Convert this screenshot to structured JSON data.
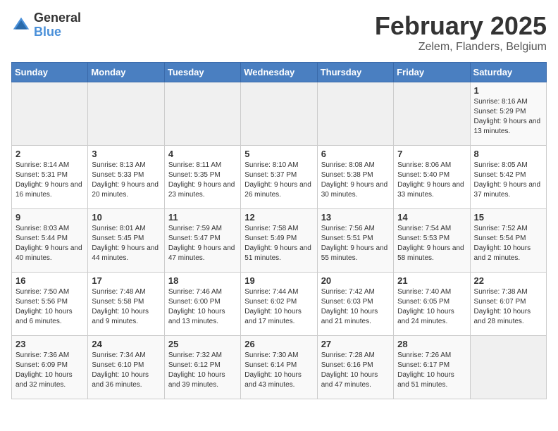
{
  "header": {
    "logo_general": "General",
    "logo_blue": "Blue",
    "title": "February 2025",
    "location": "Zelem, Flanders, Belgium"
  },
  "weekdays": [
    "Sunday",
    "Monday",
    "Tuesday",
    "Wednesday",
    "Thursday",
    "Friday",
    "Saturday"
  ],
  "weeks": [
    [
      {
        "day": "",
        "info": ""
      },
      {
        "day": "",
        "info": ""
      },
      {
        "day": "",
        "info": ""
      },
      {
        "day": "",
        "info": ""
      },
      {
        "day": "",
        "info": ""
      },
      {
        "day": "",
        "info": ""
      },
      {
        "day": "1",
        "info": "Sunrise: 8:16 AM\nSunset: 5:29 PM\nDaylight: 9 hours and 13 minutes."
      }
    ],
    [
      {
        "day": "2",
        "info": "Sunrise: 8:14 AM\nSunset: 5:31 PM\nDaylight: 9 hours and 16 minutes."
      },
      {
        "day": "3",
        "info": "Sunrise: 8:13 AM\nSunset: 5:33 PM\nDaylight: 9 hours and 20 minutes."
      },
      {
        "day": "4",
        "info": "Sunrise: 8:11 AM\nSunset: 5:35 PM\nDaylight: 9 hours and 23 minutes."
      },
      {
        "day": "5",
        "info": "Sunrise: 8:10 AM\nSunset: 5:37 PM\nDaylight: 9 hours and 26 minutes."
      },
      {
        "day": "6",
        "info": "Sunrise: 8:08 AM\nSunset: 5:38 PM\nDaylight: 9 hours and 30 minutes."
      },
      {
        "day": "7",
        "info": "Sunrise: 8:06 AM\nSunset: 5:40 PM\nDaylight: 9 hours and 33 minutes."
      },
      {
        "day": "8",
        "info": "Sunrise: 8:05 AM\nSunset: 5:42 PM\nDaylight: 9 hours and 37 minutes."
      }
    ],
    [
      {
        "day": "9",
        "info": "Sunrise: 8:03 AM\nSunset: 5:44 PM\nDaylight: 9 hours and 40 minutes."
      },
      {
        "day": "10",
        "info": "Sunrise: 8:01 AM\nSunset: 5:45 PM\nDaylight: 9 hours and 44 minutes."
      },
      {
        "day": "11",
        "info": "Sunrise: 7:59 AM\nSunset: 5:47 PM\nDaylight: 9 hours and 47 minutes."
      },
      {
        "day": "12",
        "info": "Sunrise: 7:58 AM\nSunset: 5:49 PM\nDaylight: 9 hours and 51 minutes."
      },
      {
        "day": "13",
        "info": "Sunrise: 7:56 AM\nSunset: 5:51 PM\nDaylight: 9 hours and 55 minutes."
      },
      {
        "day": "14",
        "info": "Sunrise: 7:54 AM\nSunset: 5:53 PM\nDaylight: 9 hours and 58 minutes."
      },
      {
        "day": "15",
        "info": "Sunrise: 7:52 AM\nSunset: 5:54 PM\nDaylight: 10 hours and 2 minutes."
      }
    ],
    [
      {
        "day": "16",
        "info": "Sunrise: 7:50 AM\nSunset: 5:56 PM\nDaylight: 10 hours and 6 minutes."
      },
      {
        "day": "17",
        "info": "Sunrise: 7:48 AM\nSunset: 5:58 PM\nDaylight: 10 hours and 9 minutes."
      },
      {
        "day": "18",
        "info": "Sunrise: 7:46 AM\nSunset: 6:00 PM\nDaylight: 10 hours and 13 minutes."
      },
      {
        "day": "19",
        "info": "Sunrise: 7:44 AM\nSunset: 6:02 PM\nDaylight: 10 hours and 17 minutes."
      },
      {
        "day": "20",
        "info": "Sunrise: 7:42 AM\nSunset: 6:03 PM\nDaylight: 10 hours and 21 minutes."
      },
      {
        "day": "21",
        "info": "Sunrise: 7:40 AM\nSunset: 6:05 PM\nDaylight: 10 hours and 24 minutes."
      },
      {
        "day": "22",
        "info": "Sunrise: 7:38 AM\nSunset: 6:07 PM\nDaylight: 10 hours and 28 minutes."
      }
    ],
    [
      {
        "day": "23",
        "info": "Sunrise: 7:36 AM\nSunset: 6:09 PM\nDaylight: 10 hours and 32 minutes."
      },
      {
        "day": "24",
        "info": "Sunrise: 7:34 AM\nSunset: 6:10 PM\nDaylight: 10 hours and 36 minutes."
      },
      {
        "day": "25",
        "info": "Sunrise: 7:32 AM\nSunset: 6:12 PM\nDaylight: 10 hours and 39 minutes."
      },
      {
        "day": "26",
        "info": "Sunrise: 7:30 AM\nSunset: 6:14 PM\nDaylight: 10 hours and 43 minutes."
      },
      {
        "day": "27",
        "info": "Sunrise: 7:28 AM\nSunset: 6:16 PM\nDaylight: 10 hours and 47 minutes."
      },
      {
        "day": "28",
        "info": "Sunrise: 7:26 AM\nSunset: 6:17 PM\nDaylight: 10 hours and 51 minutes."
      },
      {
        "day": "",
        "info": ""
      }
    ]
  ]
}
